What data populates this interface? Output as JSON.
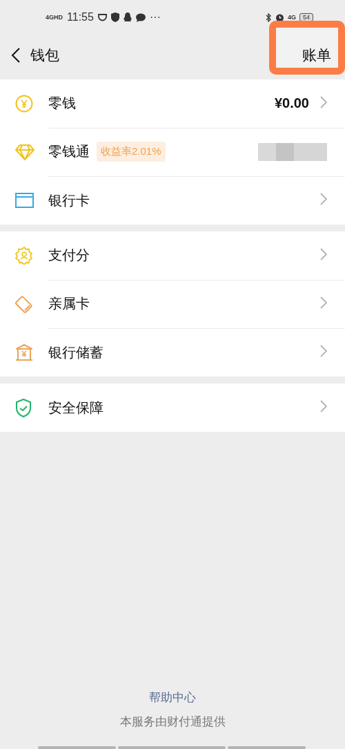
{
  "status_bar": {
    "network_left": "4GHD",
    "time": "11:55",
    "more": "···",
    "network_right": "4G",
    "battery": "54"
  },
  "header": {
    "title": "钱包",
    "action": "账单",
    "action_highlighted": true
  },
  "sections": [
    {
      "rows": [
        {
          "label": "零钱",
          "value": "¥0.00",
          "chevron": true
        },
        {
          "label": "零钱通",
          "badge": "收益率2.01%",
          "redacted": true,
          "chevron": false
        },
        {
          "label": "银行卡",
          "chevron": true
        }
      ]
    },
    {
      "rows": [
        {
          "label": "支付分",
          "chevron": true
        },
        {
          "label": "亲属卡",
          "chevron": true
        },
        {
          "label": "银行储蓄",
          "chevron": true
        }
      ]
    },
    {
      "rows": [
        {
          "label": "安全保障",
          "chevron": true
        }
      ]
    }
  ],
  "footer": {
    "link": "帮助中心",
    "note": "本服务由财付通提供"
  }
}
